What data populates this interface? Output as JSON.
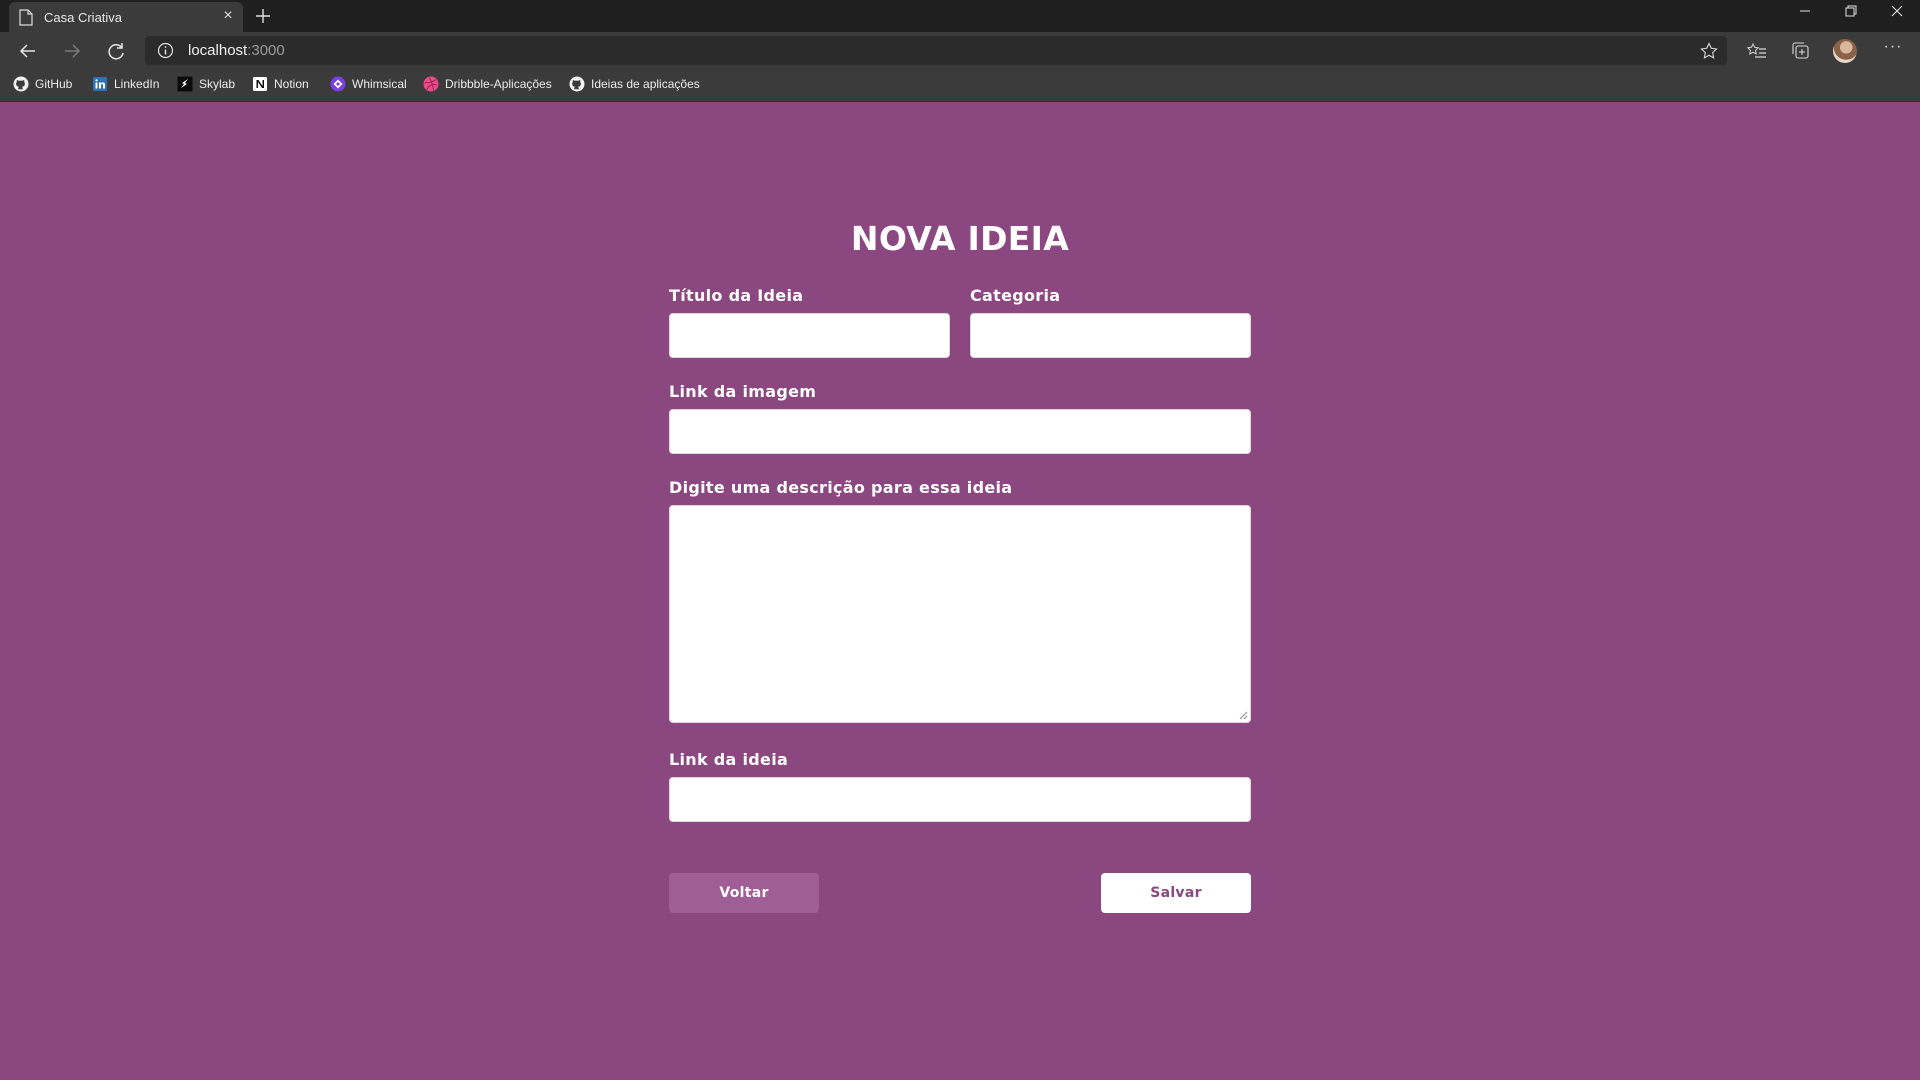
{
  "browser": {
    "tab_title": "Casa Criativa",
    "url_host": "localhost",
    "url_port": ":3000",
    "bookmarks": [
      {
        "label": "GitHub",
        "icon": "github-icon"
      },
      {
        "label": "LinkedIn",
        "icon": "linkedin-icon"
      },
      {
        "label": "Skylab",
        "icon": "skylab-icon"
      },
      {
        "label": "Notion",
        "icon": "notion-icon"
      },
      {
        "label": "Whimsical",
        "icon": "whimsical-icon"
      },
      {
        "label": "Dribbble-Aplicações",
        "icon": "dribbble-icon"
      },
      {
        "label": "Ideias de aplicações",
        "icon": "github-icon"
      }
    ]
  },
  "form": {
    "heading": "NOVA IDEIA",
    "title_label": "Título da Ideia",
    "title_value": "",
    "category_label": "Categoria",
    "category_value": "",
    "image_label": "Link da imagem",
    "image_value": "",
    "description_label": "Digite uma descrição para essa ideia",
    "description_value": "",
    "link_label": "Link da ideia",
    "link_value": "",
    "back_button": "Voltar",
    "save_button": "Salvar"
  },
  "colors": {
    "background": "#8b4880",
    "back_button": "#9f5e95",
    "save_text": "#8b4880",
    "chrome_dark": "#1f1f1f",
    "chrome": "#3b3b3b"
  }
}
